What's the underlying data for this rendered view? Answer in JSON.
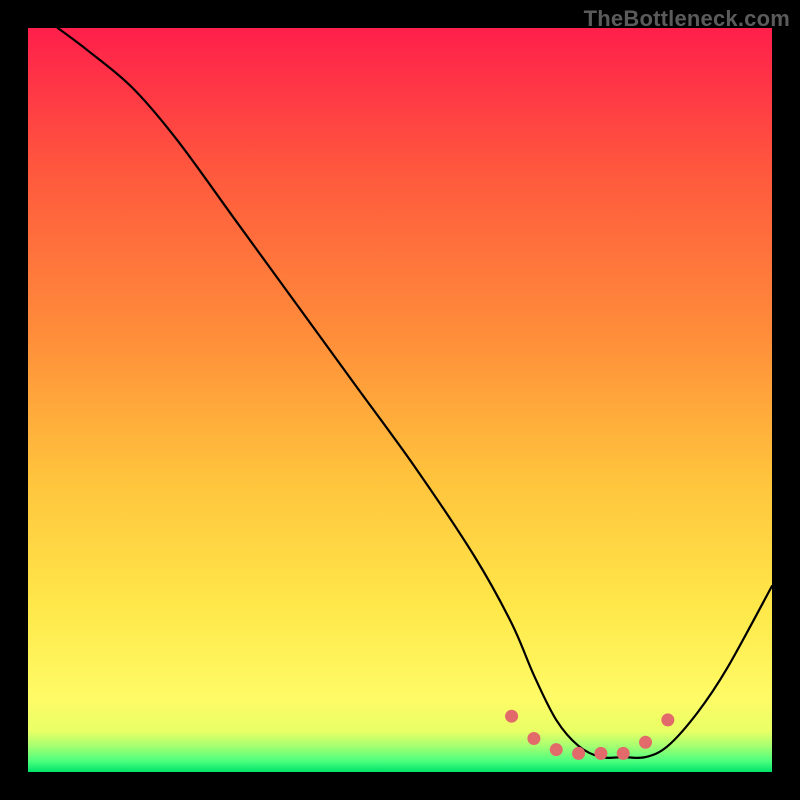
{
  "watermark": "TheBottleneck.com",
  "colors": {
    "page_bg": "#000000",
    "watermark": "#5b5b5b",
    "curve_stroke": "#000000",
    "marker_fill": "#e26a6a",
    "gradient_stops": [
      {
        "offset": 0.0,
        "color": "#ff1f4b"
      },
      {
        "offset": 0.2,
        "color": "#ff5a3d"
      },
      {
        "offset": 0.42,
        "color": "#ff8f3a"
      },
      {
        "offset": 0.6,
        "color": "#ffc23c"
      },
      {
        "offset": 0.78,
        "color": "#ffe84a"
      },
      {
        "offset": 0.9,
        "color": "#fffb66"
      },
      {
        "offset": 0.945,
        "color": "#e9ff65"
      },
      {
        "offset": 0.965,
        "color": "#a6ff70"
      },
      {
        "offset": 0.985,
        "color": "#4dff7e"
      },
      {
        "offset": 1.0,
        "color": "#00e46a"
      }
    ]
  },
  "chart_data": {
    "type": "line",
    "title": "",
    "xlabel": "",
    "ylabel": "",
    "xlim": [
      0,
      100
    ],
    "ylim": [
      0,
      100
    ],
    "grid": false,
    "legend": false,
    "series": [
      {
        "name": "bottleneck-curve",
        "x": [
          4,
          8,
          14,
          20,
          28,
          36,
          44,
          52,
          60,
          65,
          68,
          71,
          74,
          77,
          80,
          83,
          86,
          90,
          94,
          100
        ],
        "y": [
          100,
          97,
          92,
          85,
          74,
          63,
          52,
          41,
          29,
          20,
          13,
          7,
          3.5,
          2,
          2,
          2,
          3.5,
          8,
          14,
          25
        ]
      }
    ],
    "markers": {
      "name": "optimal-range-markers",
      "x": [
        65,
        68,
        71,
        74,
        77,
        80,
        83,
        86
      ],
      "y": [
        7.5,
        4.5,
        3,
        2.5,
        2.5,
        2.5,
        4,
        7
      ]
    },
    "annotations": []
  }
}
